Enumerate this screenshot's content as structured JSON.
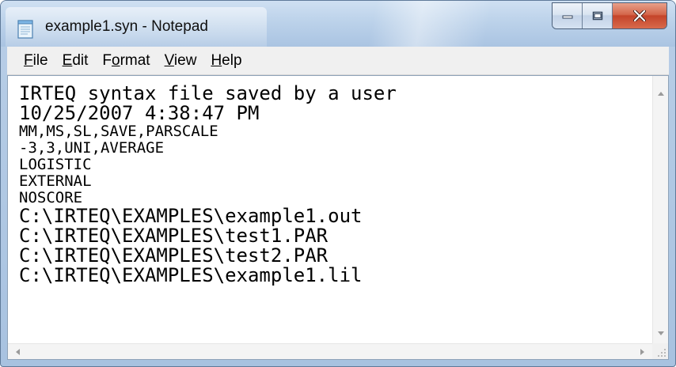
{
  "window": {
    "title": "example1.syn - Notepad",
    "icon": "notepad-icon"
  },
  "caption_buttons": {
    "minimize_icon": "minimize-icon",
    "maximize_icon": "maximize-icon",
    "close_icon": "close-icon",
    "close_color": "#c4442a"
  },
  "menu": {
    "items": [
      {
        "mnemonic": "F",
        "rest": "ile"
      },
      {
        "mnemonic": "E",
        "rest": "dit"
      },
      {
        "pre": "F",
        "mnemonic": "o",
        "rest": "rmat"
      },
      {
        "mnemonic": "V",
        "rest": "iew"
      },
      {
        "mnemonic": "H",
        "rest": "elp"
      }
    ]
  },
  "document": {
    "lines": [
      "IRTEQ syntax file saved by a user",
      "10/25/2007 4:38:47 PM",
      "MM,MS,SL,SAVE,PARSCALE",
      "-3,3,UNI,AVERAGE",
      "LOGISTIC",
      "EXTERNAL",
      "NOSCORE",
      "C:\\IRTEQ\\EXAMPLES\\example1.out",
      "C:\\IRTEQ\\EXAMPLES\\test1.PAR",
      "C:\\IRTEQ\\EXAMPLES\\test2.PAR",
      "C:\\IRTEQ\\EXAMPLES\\example1.lil"
    ]
  },
  "scrollbars": {
    "up_icon": "scroll-up-arrow-icon",
    "down_icon": "scroll-down-arrow-icon",
    "left_icon": "scroll-left-arrow-icon",
    "right_icon": "scroll-right-arrow-icon",
    "grip_icon": "size-grip-icon"
  }
}
